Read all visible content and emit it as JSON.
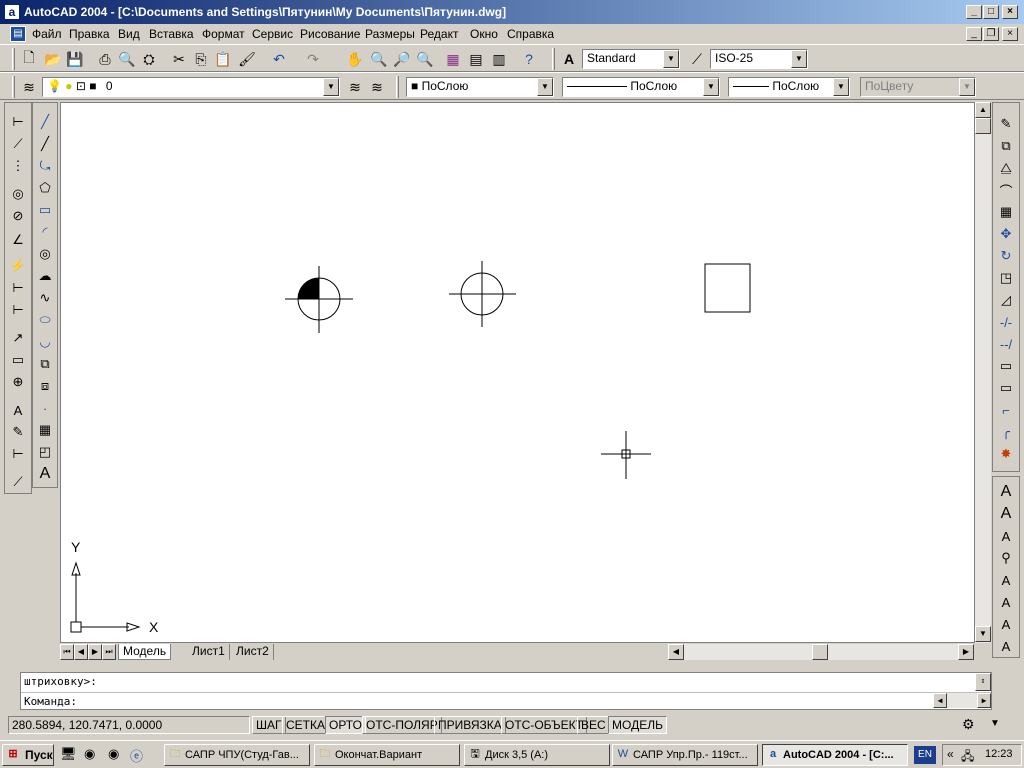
{
  "window": {
    "title": "AutoCAD 2004 - [C:\\Documents and Settings\\Пятунин\\My Documents\\Пятунин.dwg]",
    "app_icon_glyph": "a"
  },
  "menu": {
    "items": [
      "Файл",
      "Правка",
      "Вид",
      "Вставка",
      "Формат",
      "Сервис",
      "Рисование",
      "Размеры",
      "Редакт",
      "Окно",
      "Справка"
    ]
  },
  "toolbar": {
    "text_style": "Standard",
    "dim_style": "ISO-25"
  },
  "layers": {
    "current_layer": "0",
    "color": "ПоСлою",
    "linetype": "ПоСлою",
    "lineweight": "ПоСлою",
    "plotstyle": "ПоЦвету"
  },
  "tabs": [
    "Модель",
    "Лист1",
    "Лист2"
  ],
  "ucs": {
    "x_label": "X",
    "y_label": "Y"
  },
  "command": {
    "history": "штриховку>:",
    "prompt": "Команда:"
  },
  "status": {
    "coords": "280.5894, 120.7471, 0.0000",
    "buttons": [
      "ШАГ",
      "СЕТКА",
      "ОРТО",
      "ОТС-ПОЛЯР",
      "ПРИВЯЗКА",
      "ОТС-ОБЪЕКТ",
      "ВЕС",
      "МОДЕЛЬ"
    ],
    "active": [
      "ОРТО",
      "МОДЕЛЬ"
    ]
  },
  "taskbar": {
    "start": "Пуск",
    "tasks": [
      "САПР ЧПУ(Студ-Гав...",
      "Окончат.Вариант",
      "Диск 3,5 (A:)",
      "САПР Упр.Пр.- 119ст...",
      "AutoCAD 2004 - [C:..."
    ],
    "lang": "EN",
    "time": "12:23"
  },
  "colors": {
    "title_start": "#0a246a",
    "title_end": "#a6caf0",
    "face": "#d4d0c8"
  }
}
